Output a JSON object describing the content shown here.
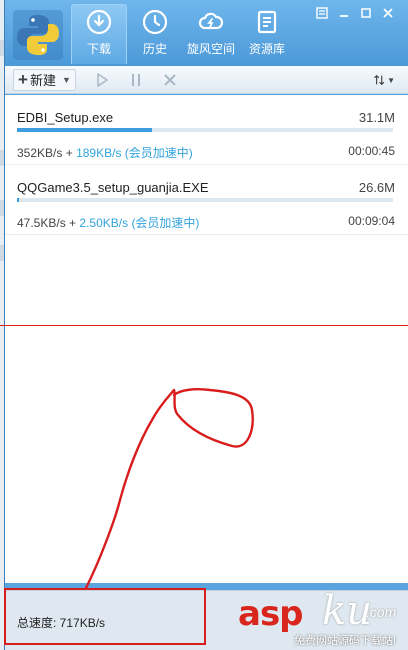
{
  "app": {
    "nav": [
      {
        "label": "下载",
        "icon": "download-icon",
        "active": true
      },
      {
        "label": "历史",
        "icon": "history-icon",
        "active": false
      },
      {
        "label": "旋风空间",
        "icon": "cloud-icon",
        "active": false
      },
      {
        "label": "资源库",
        "icon": "library-icon",
        "active": false
      }
    ]
  },
  "toolbar": {
    "new_label": "新建",
    "new_icon": "plus-icon",
    "play_icon": "play-icon",
    "pause_icon": "pause-icon",
    "delete_icon": "close-icon",
    "sort_icon": "sort-icon"
  },
  "downloads": [
    {
      "filename": "EDBI_Setup.exe",
      "size": "31.1M",
      "progress": 0.36,
      "speed": "352KB/s",
      "plus": "+",
      "accel": "189KB/s (会员加速中)",
      "time_left": "00:00:45"
    },
    {
      "filename": "QQGame3.5_setup_guanjia.EXE",
      "size": "26.6M",
      "progress": 0.005,
      "speed": "47.5KB/s",
      "plus": "+",
      "accel": "2.50KB/s (会员加速中)",
      "time_left": "00:09:04"
    }
  ],
  "status": {
    "total_speed": "总速度: 717KB/s"
  },
  "watermark": {
    "main": "asp",
    "ku": "ku",
    "com": ".com",
    "sub": "免费网站源码下载站!"
  },
  "colors": {
    "accent": "#3e9bdd",
    "accel_text": "#32a3dd",
    "annotation_red": "#d91d1d"
  }
}
